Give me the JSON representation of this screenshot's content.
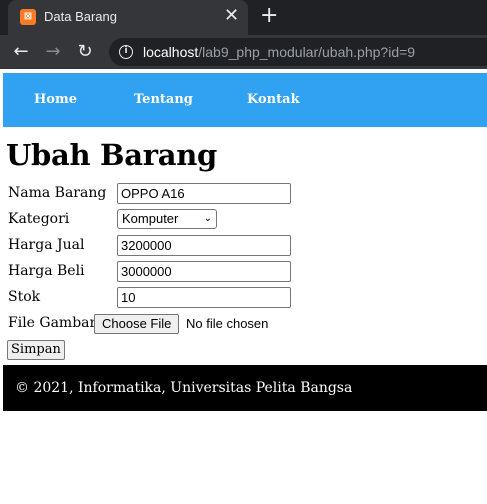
{
  "browser": {
    "tab_title": "Data Barang",
    "tab_close": "✕",
    "new_tab": "+",
    "favicon_letter": "⊠",
    "url_host": "localhost",
    "url_path": "/lab9_php_modular/ubah.php?id=9",
    "icons": {
      "back": "arrow-left-icon",
      "forward": "arrow-right-icon",
      "reload": "reload-icon",
      "info": "info-icon"
    }
  },
  "nav": {
    "home": "Home",
    "about": "Tentang",
    "contact": "Kontak"
  },
  "page": {
    "title": "Ubah Barang"
  },
  "form": {
    "nama_label": "Nama Barang",
    "nama_value": "OPPO A16",
    "kategori_label": "Kategori",
    "kategori_value": "Komputer",
    "harga_jual_label": "Harga Jual",
    "harga_jual_value": "3200000",
    "harga_beli_label": "Harga Beli",
    "harga_beli_value": "3000000",
    "stok_label": "Stok",
    "stok_value": "10",
    "file_label": "File Gambar",
    "file_button": "Choose File",
    "file_status": "No file chosen",
    "submit": "Simpan"
  },
  "footer": {
    "text": "© 2021, Informatika, Universitas Pelita Bangsa"
  },
  "colors": {
    "navbar": "#30a2f1",
    "footer": "#000000",
    "chrome_dark": "#202124",
    "chrome_tab": "#35363a",
    "favicon": "#fb7a24"
  }
}
